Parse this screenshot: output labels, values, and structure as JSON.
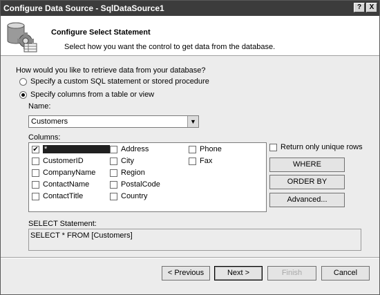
{
  "window": {
    "title": "Configure Data Source - SqlDataSource1",
    "help_label": "?",
    "close_label": "X"
  },
  "header": {
    "title": "Configure Select Statement",
    "subtitle": "Select how you want the control to get data from the database."
  },
  "retrieve": {
    "question": "How would you like to retrieve data from your database?",
    "options": [
      {
        "label": "Specify a custom SQL statement or stored procedure",
        "checked": false
      },
      {
        "label": "Specify columns from a table or view",
        "checked": true
      }
    ]
  },
  "name_label": "Name:",
  "name_value": "Customers",
  "columns_label": "Columns:",
  "columns": [
    {
      "label": "*",
      "checked": true,
      "selected": true
    },
    {
      "label": "CustomerID",
      "checked": false
    },
    {
      "label": "CompanyName",
      "checked": false
    },
    {
      "label": "ContactName",
      "checked": false
    },
    {
      "label": "ContactTitle",
      "checked": false
    },
    {
      "label": "Address",
      "checked": false
    },
    {
      "label": "City",
      "checked": false
    },
    {
      "label": "Region",
      "checked": false
    },
    {
      "label": "PostalCode",
      "checked": false
    },
    {
      "label": "Country",
      "checked": false
    },
    {
      "label": "Phone",
      "checked": false
    },
    {
      "label": "Fax",
      "checked": false
    }
  ],
  "unique_rows_label": "Return only unique rows",
  "buttons": {
    "where": "WHERE",
    "order_by": "ORDER BY",
    "advanced": "Advanced..."
  },
  "select_statement_label": "SELECT Statement:",
  "select_statement_value": "SELECT * FROM [Customers]",
  "footer": {
    "previous": "< Previous",
    "next": "Next >",
    "finish": "Finish",
    "cancel": "Cancel"
  }
}
